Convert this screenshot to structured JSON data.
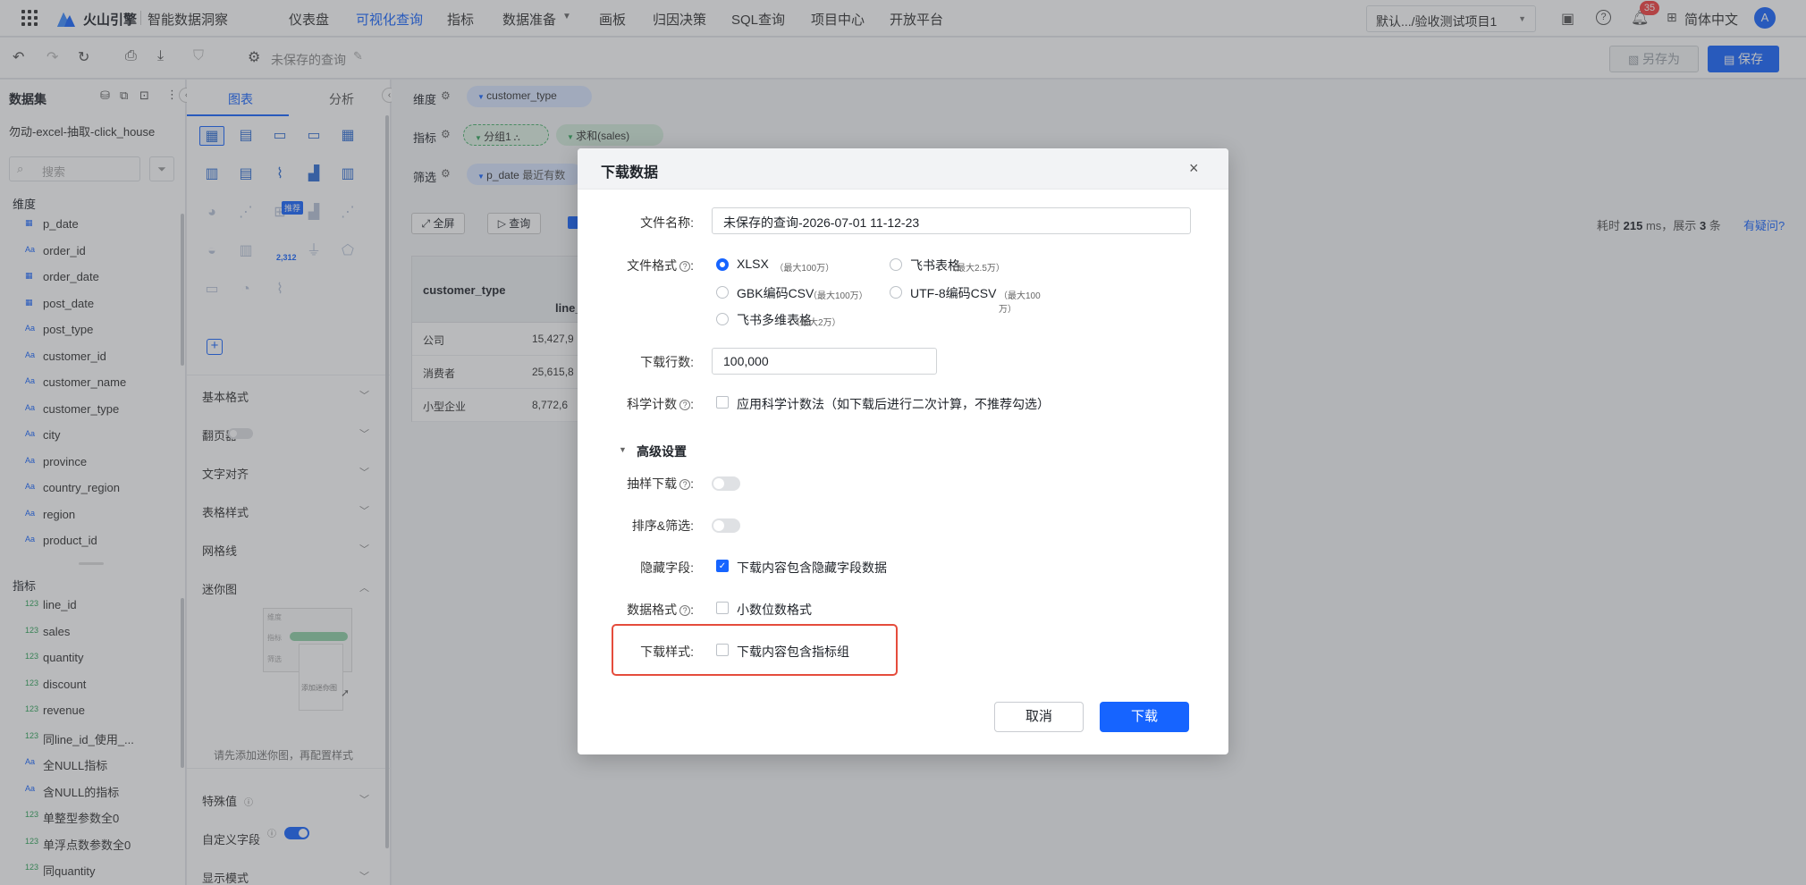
{
  "topbar": {
    "brand": "火山引擎",
    "product": "智能数据洞察",
    "nav": [
      "仪表盘",
      "可视化查询",
      "指标",
      "数据准备",
      "画板",
      "归因决策",
      "SQL查询",
      "项目中心",
      "开放平台"
    ],
    "active_nav": "可视化查询",
    "project": "默认.../验收测试项目1",
    "notification_count": "35",
    "language": "简体中文",
    "avatar": "A"
  },
  "toolbar": {
    "query_name": "未保存的查询",
    "save_as": "另存为",
    "save": "保存"
  },
  "left_panel": {
    "title": "数据集",
    "dataset": "勿动-excel-抽取-click_house",
    "search_placeholder": "搜索",
    "dimension_title": "维度",
    "dimensions": [
      {
        "type": "date",
        "name": "p_date"
      },
      {
        "type": "Aa",
        "name": "order_id"
      },
      {
        "type": "date",
        "name": "order_date"
      },
      {
        "type": "date",
        "name": "post_date"
      },
      {
        "type": "Aa",
        "name": "post_type"
      },
      {
        "type": "Aa",
        "name": "customer_id"
      },
      {
        "type": "Aa",
        "name": "customer_name"
      },
      {
        "type": "Aa",
        "name": "customer_type"
      },
      {
        "type": "Aa",
        "name": "city"
      },
      {
        "type": "Aa",
        "name": "province"
      },
      {
        "type": "Aa",
        "name": "country_region"
      },
      {
        "type": "Aa",
        "name": "region"
      },
      {
        "type": "Aa",
        "name": "product_id"
      }
    ],
    "metric_title": "指标",
    "metrics": [
      {
        "type": "123",
        "name": "line_id"
      },
      {
        "type": "123",
        "name": "sales"
      },
      {
        "type": "123",
        "name": "quantity"
      },
      {
        "type": "123",
        "name": "discount"
      },
      {
        "type": "123",
        "name": "revenue"
      },
      {
        "type": "123",
        "name": "同line_id_使用_..."
      },
      {
        "type": "Aa",
        "name": "全NULL指标"
      },
      {
        "type": "Aa",
        "name": "含NULL的指标"
      },
      {
        "type": "123",
        "name": "单整型参数全0"
      },
      {
        "type": "123",
        "name": "单浮点数参数全0"
      },
      {
        "type": "123",
        "name": "同quantity"
      }
    ]
  },
  "mid_panel": {
    "tabs": [
      "图表",
      "分析"
    ],
    "recommend_badge": "推荐",
    "kpi_sample": "2,312",
    "sections": [
      "基本格式",
      "翻页器",
      "文字对齐",
      "表格样式",
      "网格线",
      "迷你图"
    ],
    "mini_labels": [
      "维度",
      "指标",
      "筛选"
    ],
    "mini_add": "添加迷你图",
    "mini_hint": "请先添加迷你图，再配置样式",
    "sections2": [
      "特殊值",
      "自定义字段",
      "显示模式"
    ]
  },
  "query_area": {
    "dimension_label": "维度",
    "dimension_chip": "customer_type",
    "metric_label": "指标",
    "metric_chips": [
      "分组1",
      "求和(sales)"
    ],
    "filter_label": "筛选",
    "filter_chip": "p_date",
    "filter_chip_tail": "最近有数",
    "fullscreen": "全屏",
    "query": "查询",
    "stats_prefix": "耗时",
    "stats_ms": "215",
    "stats_mid": "ms，展示",
    "stats_count": "3",
    "stats_suffix": "条",
    "help_link": "有疑问?",
    "table_header": [
      "customer_type",
      "line_"
    ],
    "table_rows": [
      [
        "公司",
        "15,427,9"
      ],
      [
        "消费者",
        "25,615,8"
      ],
      [
        "小型企业",
        "8,772,6"
      ]
    ]
  },
  "dialog": {
    "title": "下载数据",
    "file_name_label": "文件名称:",
    "file_name_value": "未保存的查询-2026-07-01 11-12-23",
    "file_format_label": "文件格式",
    "formats": [
      {
        "label": "XLSX",
        "limit": "（最大100万）",
        "selected": true
      },
      {
        "label": "飞书表格",
        "limit": "（最大2.5万）",
        "selected": false
      },
      {
        "label": "GBK编码CSV",
        "limit": "（最大100万）",
        "selected": false
      },
      {
        "label": "UTF-8编码CSV",
        "limit": "（最大100万）",
        "selected": false
      },
      {
        "label": "飞书多维表格",
        "limit": "（最大2万）",
        "selected": false
      }
    ],
    "rows_label": "下载行数:",
    "rows_value": "100,000",
    "sci_label": "科学计数",
    "sci_option": "应用科学计数法（如下载后进行二次计算，不推荐勾选）",
    "advanced_title": "高级设置",
    "sample_label": "抽样下载",
    "sort_filter_label": "排序&筛选:",
    "hidden_label": "隐藏字段:",
    "hidden_option": "下载内容包含隐藏字段数据",
    "data_format_label": "数据格式",
    "data_format_option": "小数位数格式",
    "style_label": "下载样式:",
    "style_option": "下载内容包含指标组",
    "cancel": "取消",
    "download": "下载",
    "highlight_color": "#e54c3c",
    "primary_color": "#1664ff"
  }
}
